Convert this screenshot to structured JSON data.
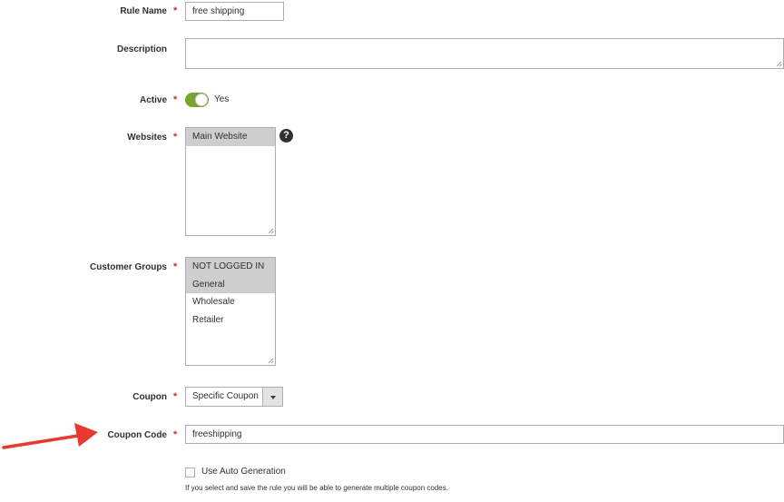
{
  "form": {
    "rule_name": {
      "label": "Rule Name",
      "value": "free shipping"
    },
    "description": {
      "label": "Description",
      "value": ""
    },
    "active": {
      "label": "Active",
      "state_label": "Yes"
    },
    "websites": {
      "label": "Websites",
      "options": [
        "Main Website"
      ],
      "help_icon": "?"
    },
    "customer_groups": {
      "label": "Customer Groups",
      "options": [
        "NOT LOGGED IN",
        "General",
        "Wholesale",
        "Retailer"
      ]
    },
    "coupon": {
      "label": "Coupon",
      "selected": "Specific Coupon"
    },
    "coupon_code": {
      "label": "Coupon Code",
      "value": "freeshipping"
    },
    "auto_generation": {
      "label": "Use Auto Generation",
      "note": "If you select and save the rule you will be able to generate multiple coupon codes."
    },
    "required_mark": "*"
  },
  "colors": {
    "required": "#e22626",
    "toggle_on": "#79a22e",
    "arrow": "#e8392f",
    "selected_option": "#cecece"
  }
}
